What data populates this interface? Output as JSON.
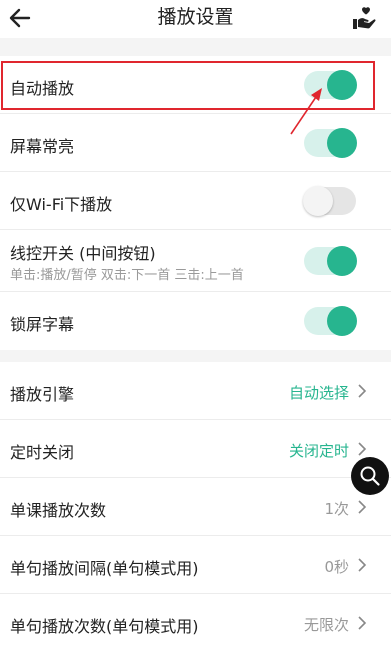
{
  "header": {
    "title": "播放设置",
    "back_icon": "arrow-left-icon",
    "action_icon": "heart-hand-icon"
  },
  "toggles": [
    {
      "label": "自动播放",
      "on": true
    },
    {
      "label": "屏幕常亮",
      "on": true
    },
    {
      "label": "仅Wi-Fi下播放",
      "on": false
    },
    {
      "label": "线控开关 (中间按钮)",
      "sub": "单击:播放/暂停 双击:下一首 三击:上一首",
      "on": true
    },
    {
      "label": "锁屏字幕",
      "on": true
    }
  ],
  "options": [
    {
      "label": "播放引擎",
      "value": "自动选择",
      "style": "accent"
    },
    {
      "label": "定时关闭",
      "value": "关闭定时",
      "style": "accent"
    },
    {
      "label": "单课播放次数",
      "value": "1次",
      "style": "muted"
    },
    {
      "label": "单句播放间隔(单句模式用)",
      "value": "0秒",
      "style": "muted"
    },
    {
      "label": "单句播放次数(单句模式用)",
      "value": "无限次",
      "style": "muted"
    }
  ],
  "colors": {
    "accent": "#27b58f",
    "toggle_track_on": "#d7f1eb",
    "highlight": "#e0262e"
  },
  "floating": {
    "icon": "search-icon"
  }
}
